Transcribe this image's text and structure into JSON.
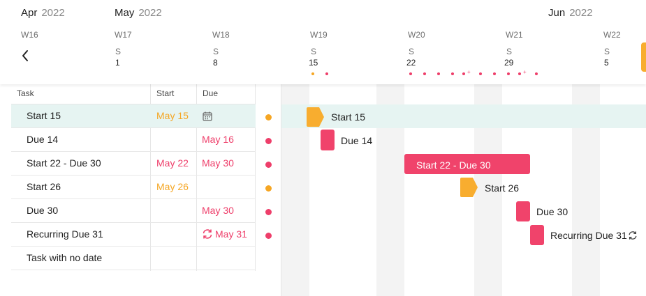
{
  "timeline": {
    "months": [
      {
        "name": "Apr",
        "year": "2022"
      },
      {
        "name": "May",
        "year": "2022"
      },
      {
        "name": "Jun",
        "year": "2022"
      }
    ],
    "weeks": [
      "W16",
      "W17",
      "W18",
      "W19",
      "W20",
      "W21",
      "W22"
    ],
    "day_letters": [
      "S",
      "S",
      "S",
      "S",
      "S",
      "S"
    ],
    "day_numbers": [
      "1",
      "8",
      "15",
      "22",
      "29",
      "5"
    ]
  },
  "table": {
    "headers": {
      "task": "Task",
      "start": "Start",
      "due": "Due"
    },
    "rows": [
      {
        "task": "Start 15",
        "start": "May 15",
        "due": "",
        "status": "orange"
      },
      {
        "task": "Due 14",
        "start": "",
        "due": "May 16",
        "status": "red"
      },
      {
        "task": "Start 22 - Due 30",
        "start": "May 22",
        "due": "May 30",
        "status": "red"
      },
      {
        "task": "Start 26",
        "start": "May 26",
        "due": "",
        "status": "orange"
      },
      {
        "task": "Due 30",
        "start": "",
        "due": "May 30",
        "status": "red"
      },
      {
        "task": "Recurring Due 31",
        "start": "",
        "due": "May 31",
        "status": "red"
      },
      {
        "task": "Task with no date",
        "start": "",
        "due": "",
        "status": ""
      }
    ]
  },
  "gantt": {
    "labels": [
      "Start 15",
      "Due 14",
      "Start 22 - Due 30",
      "Start 26",
      "Due 30",
      "Recurring Due 31"
    ]
  },
  "colors": {
    "red": "#ee3e6a",
    "orange": "#f5a623",
    "selection": "#e6f4f2"
  },
  "icons": {
    "back": "chevron-left-icon",
    "calendar": "calendar-icon",
    "recurring": "recurring-icon"
  }
}
